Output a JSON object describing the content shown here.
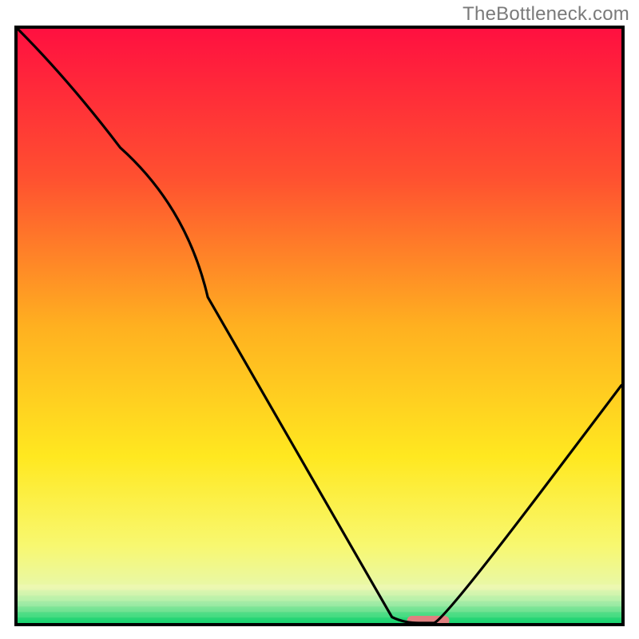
{
  "watermark": "TheBottleneck.com",
  "chart_data": {
    "type": "line",
    "title": "",
    "xlabel": "",
    "ylabel": "",
    "xlim": [
      0,
      100
    ],
    "ylim": [
      0,
      100
    ],
    "series": [
      {
        "name": "bottleneck-curve",
        "x": [
          0,
          17,
          28,
          62,
          64,
          69,
          71,
          100
        ],
        "values": [
          100,
          80,
          70,
          1,
          0,
          0,
          1,
          40
        ]
      }
    ],
    "marker": {
      "name": "optimal-range",
      "x_center": 68,
      "y": 0,
      "width": 7,
      "color": "#e08080"
    },
    "background": {
      "heatmap_gradient_stops": [
        {
          "offset": 0.0,
          "color": "#ff1040"
        },
        {
          "offset": 0.25,
          "color": "#ff5030"
        },
        {
          "offset": 0.5,
          "color": "#ffb020"
        },
        {
          "offset": 0.72,
          "color": "#ffe820"
        },
        {
          "offset": 0.87,
          "color": "#f8f870"
        },
        {
          "offset": 0.94,
          "color": "#e8f8a8"
        },
        {
          "offset": 0.965,
          "color": "#a8f0b0"
        },
        {
          "offset": 1.0,
          "color": "#10d870"
        }
      ]
    }
  }
}
